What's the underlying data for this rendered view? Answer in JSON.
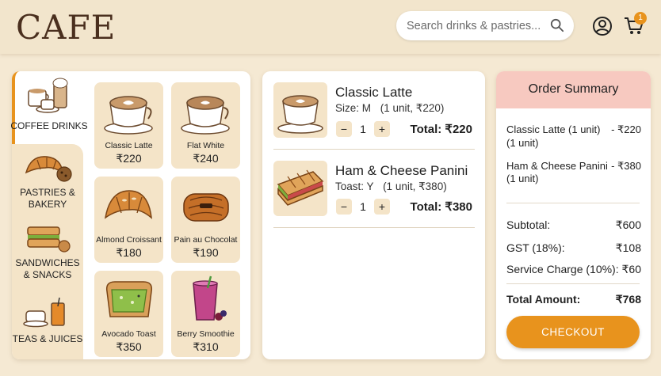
{
  "app": {
    "logo": "CAFE"
  },
  "header": {
    "search_placeholder": "Search drinks & pastries...",
    "cart_count": "1"
  },
  "categories": [
    {
      "label": "COFFEE DRINKS",
      "icon": "coffee-cups-icon",
      "active": true
    },
    {
      "label": "PASTRIES & BAKERY",
      "icon": "croissant-icon",
      "active": false
    },
    {
      "label": "SANDWICHES & SNACKS",
      "icon": "sandwich-icon",
      "active": false
    },
    {
      "label": "TEAS & JUICES",
      "icon": "tea-juice-icon",
      "active": false
    }
  ],
  "products": [
    {
      "name": "Classic Latte",
      "price": "₹220",
      "icon": "latte-icon"
    },
    {
      "name": "Flat White",
      "price": "₹240",
      "icon": "flat-white-icon"
    },
    {
      "name": "Almond Croissant",
      "price": "₹180",
      "icon": "croissant-icon"
    },
    {
      "name": "Pain au Chocolat",
      "price": "₹190",
      "icon": "pain-au-chocolat-icon"
    },
    {
      "name": "Avocado Toast",
      "price": "₹350",
      "icon": "avocado-toast-icon"
    },
    {
      "name": "Berry Smoothie",
      "price": "₹310",
      "icon": "smoothie-icon"
    }
  ],
  "cart": {
    "items": [
      {
        "name": "Classic Latte",
        "option": "Size: M",
        "unit_info": "(1 unit, ₹220)",
        "qty": "1",
        "total": "Total: ₹220",
        "dec": "−",
        "inc": "+"
      },
      {
        "name": "Ham & Cheese Panini",
        "option": "Toast: Y",
        "unit_info": "(1 unit, ₹380)",
        "qty": "1",
        "total": "Total: ₹380",
        "dec": "−",
        "inc": "+"
      }
    ]
  },
  "summary": {
    "title": "Order Summary",
    "lines": [
      {
        "name": "Classic Latte (1 unit)",
        "sub": "(1 unit)",
        "price": "- ₹220"
      },
      {
        "name": "Ham & Cheese Panini",
        "sub": "(1 unit)",
        "price": "- ₹380"
      }
    ],
    "subtotal_label": "Subtotal:",
    "subtotal": "₹600",
    "gst_label": "GST (18%):",
    "gst": "₹108",
    "service_label": "Service Charge (10%):",
    "service": "₹60",
    "total_label": "Total Amount:",
    "total": "₹768",
    "checkout_label": "CHECKOUT"
  },
  "colors": {
    "accent": "#e8931d",
    "card_bg": "#f4e4c8",
    "page_bg": "#f5e9d3",
    "summary_header": "#f7c9c0"
  }
}
